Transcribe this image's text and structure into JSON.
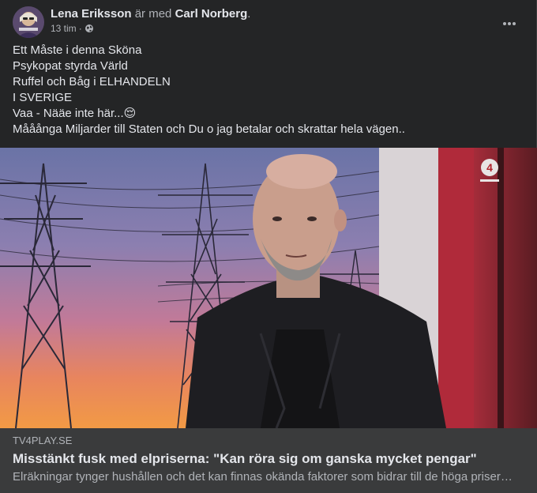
{
  "post": {
    "author": "Lena Eriksson",
    "with_text": "är med",
    "tagged": "Carl Norberg",
    "trailing_dot": ".",
    "time": "13 tim",
    "separator": "·",
    "privacy_icon": "globe-icon",
    "more_icon": "more-horizontal-icon",
    "lines": [
      "Ett Måste i denna Sköna",
      "Psykopat styrda Värld",
      "Ruffel och Båg i ELHANDELN",
      "I SVERIGE",
      "Vaa - Nääe inte här...😌",
      "Mååånga Miljarder till Staten och Du o jag betalar och skrattar hela vägen.."
    ]
  },
  "link": {
    "domain": "TV4PLAY.SE",
    "title": "Misstänkt fusk med elpriserna: \"Kan röra sig om ganska mycket pengar\"",
    "description": "Elräkningar tynger hushållen och det kan finnas okända faktorer som bidrar till de höga priser…",
    "channel_logo_text": "4"
  },
  "colors": {
    "card_bg": "#242526",
    "footer_bg": "#3a3b3c",
    "primary_text": "#e4e6eb",
    "secondary_text": "#b0b3b8"
  }
}
